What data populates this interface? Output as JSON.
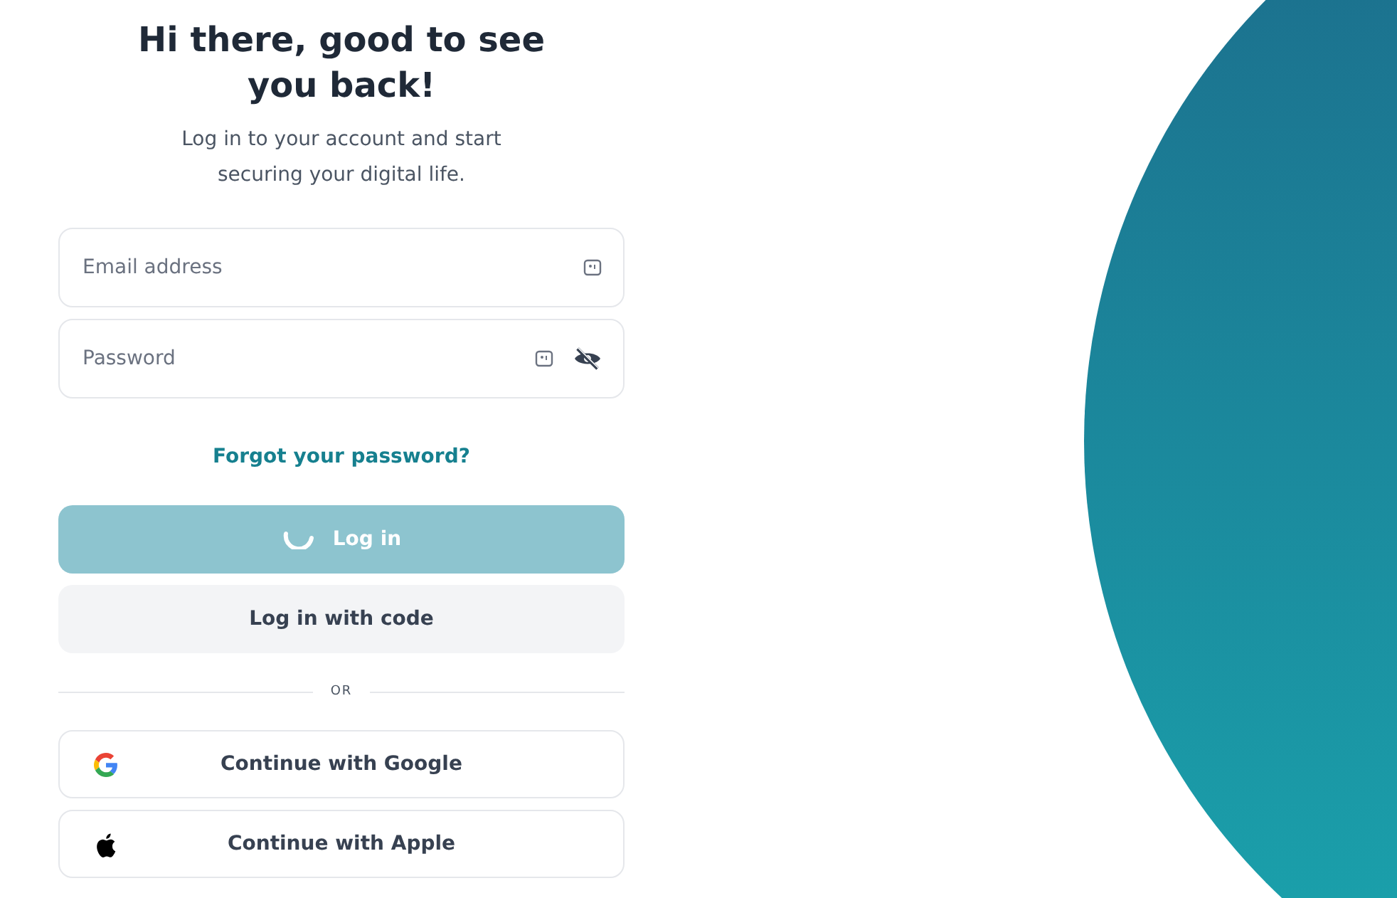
{
  "heading": "Hi there, good to see you back!",
  "subtitle": "Log in to your account and start securing your digital life.",
  "email_field": {
    "placeholder": "Email address"
  },
  "password_field": {
    "placeholder": "Password",
    "visible": false
  },
  "forgot_link": "Forgot your password?",
  "login_button": {
    "label": "Log in",
    "loading": true
  },
  "code_button": {
    "label": "Log in with code"
  },
  "divider": "OR",
  "social_buttons": [
    {
      "kind": "google",
      "label": "Continue with Google"
    },
    {
      "kind": "apple",
      "label": "Continue with Apple"
    }
  ]
}
